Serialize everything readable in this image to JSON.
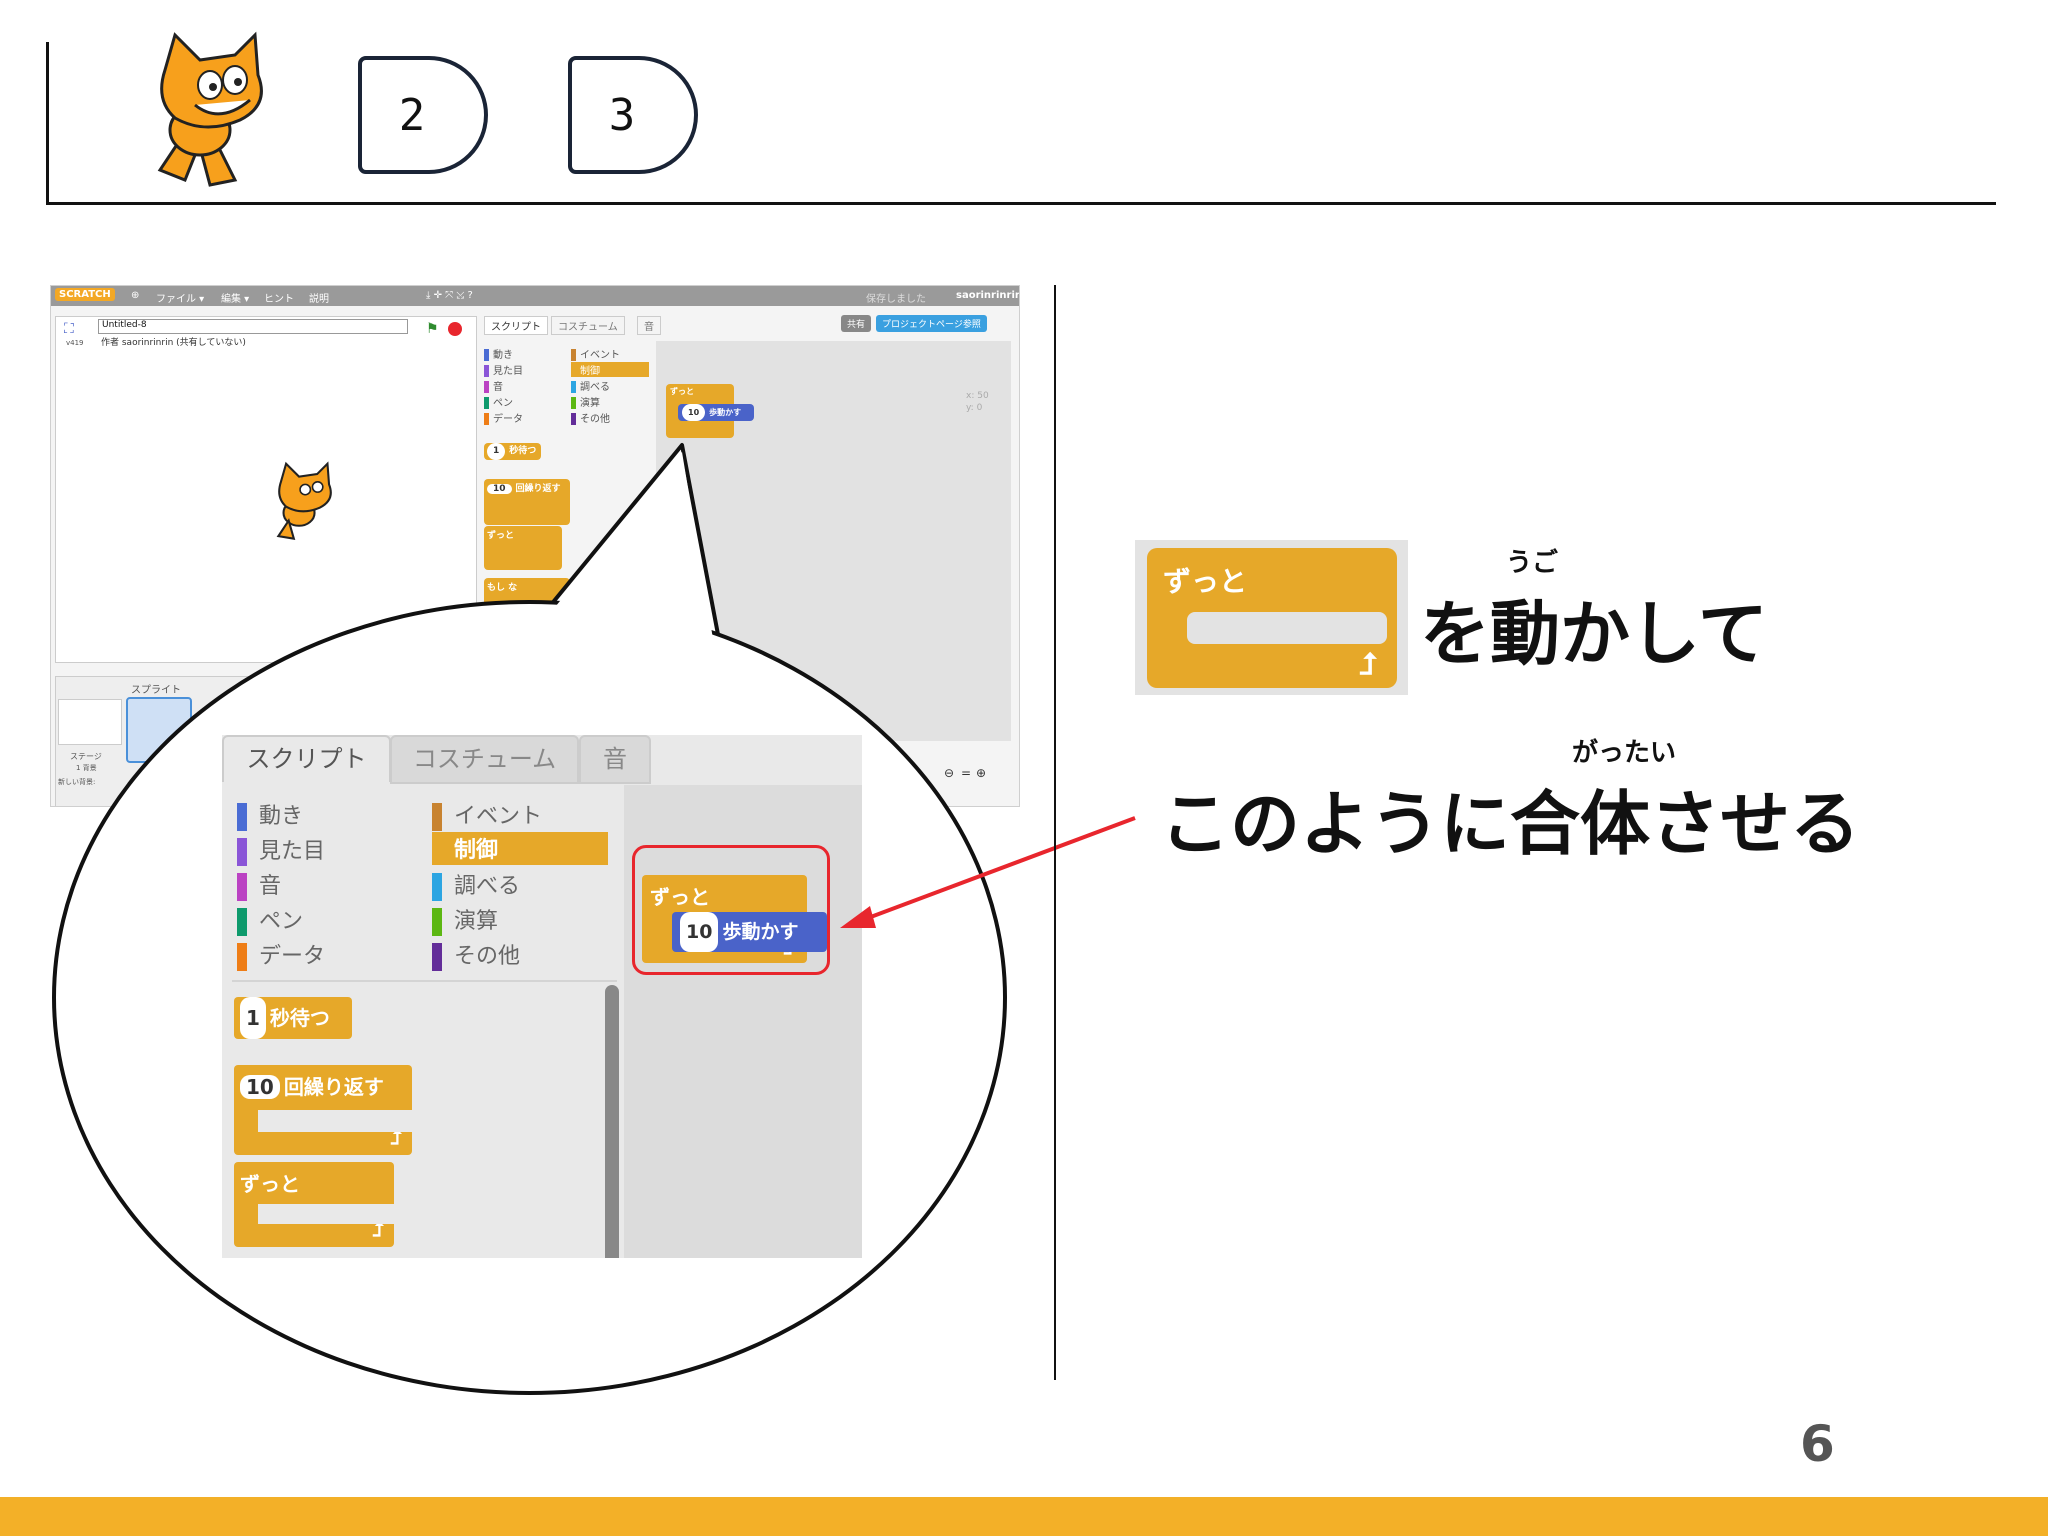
{
  "header": {
    "steps": [
      "2",
      "3"
    ]
  },
  "screenshot": {
    "menu": {
      "logo": "SCRATCH",
      "items": [
        "ファイル ▾",
        "編集 ▾",
        "ヒント",
        "説明"
      ],
      "saved": "保存しました",
      "user": "saorinrinrin"
    },
    "project_title": "Untitled-8",
    "version": "v419",
    "author": "作者 saorinrinrin (共有していない)",
    "tabs": [
      "スクリプト",
      "コスチューム",
      "音"
    ],
    "share_button": "共有",
    "project_page_button": "プロジェクトページ参照",
    "categories_left": [
      "動き",
      "見た目",
      "音",
      "ペン",
      "データ"
    ],
    "categories_right": [
      "イベント",
      "制御",
      "調べる",
      "演算",
      "その他"
    ],
    "palette_blocks": {
      "wait": {
        "value": "1",
        "label": "秒待つ"
      },
      "repeat": {
        "value": "10",
        "label": "回繰り返す"
      },
      "forever": "ずっと",
      "if_partial": "もし",
      "if_tail": "な"
    },
    "script_forever": "ずっと",
    "script_move": {
      "value": "10",
      "label": "歩動かす"
    },
    "sprite_coords": {
      "x": "x: 50",
      "y": "y: 0"
    },
    "sprites_header": "スプライト",
    "stage_label": "ステージ",
    "backdrop_count": "1 背景",
    "new_backdrop": "新しい背景:",
    "zoom_controls": "= "
  },
  "zoom": {
    "tabs": [
      "スクリプト",
      "コスチューム",
      "音"
    ],
    "categories_left": [
      "動き",
      "見た目",
      "音",
      "ペン",
      "データ"
    ],
    "categories_right": [
      "イベント",
      "制御",
      "調べる",
      "演算",
      "その他"
    ],
    "wait": {
      "value": "1",
      "label": "秒待つ"
    },
    "repeat": {
      "value": "10",
      "label": "回繰り返す"
    },
    "forever": "ずっと",
    "script_forever": "ずっと",
    "script_move": {
      "value": "10",
      "label": "歩動かす"
    }
  },
  "instructions": {
    "forever_block_label": "ずっと",
    "line1_ruby": "うご",
    "line1": "を動かして",
    "line2_ruby": "がったい",
    "line2": "このように合体させる"
  },
  "page_number": "6",
  "colors": {
    "control_block": "#e6a829",
    "motion_block": "#4a63c9",
    "highlight": "#e8262d",
    "footer": "#f3b028"
  }
}
